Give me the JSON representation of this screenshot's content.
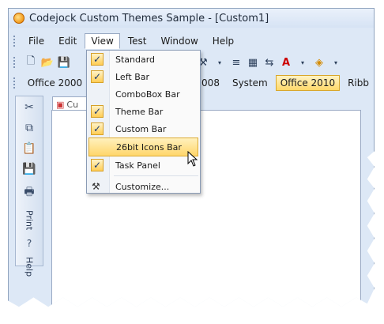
{
  "window": {
    "title": "Codejock Custom Themes Sample - [Custom1]"
  },
  "menubar": {
    "items": [
      "File",
      "Edit",
      "View",
      "Test",
      "Window",
      "Help"
    ]
  },
  "themebar": {
    "items": [
      "Office 2000",
      "al Studio 2008",
      "System",
      "Office 2010",
      "Ribb"
    ]
  },
  "leftbar": {
    "print_label": "Print",
    "help_label": "Help"
  },
  "document": {
    "tab_label": "Cu"
  },
  "view_menu": {
    "items": [
      {
        "label": "Standard",
        "checked": true
      },
      {
        "label": "Left Bar",
        "checked": true
      },
      {
        "label": "ComboBox Bar",
        "checked": false
      },
      {
        "label": "Theme Bar",
        "checked": true
      },
      {
        "label": "Custom Bar",
        "checked": true
      },
      {
        "label": "26bit Icons Bar",
        "checked": false,
        "hovered": true
      },
      {
        "label": "Task Panel",
        "checked": true
      },
      {
        "label": "Customize...",
        "icon": "tools-icon"
      }
    ]
  },
  "colors": {
    "accent": "#ffd96a",
    "frame": "#dde8f6"
  }
}
